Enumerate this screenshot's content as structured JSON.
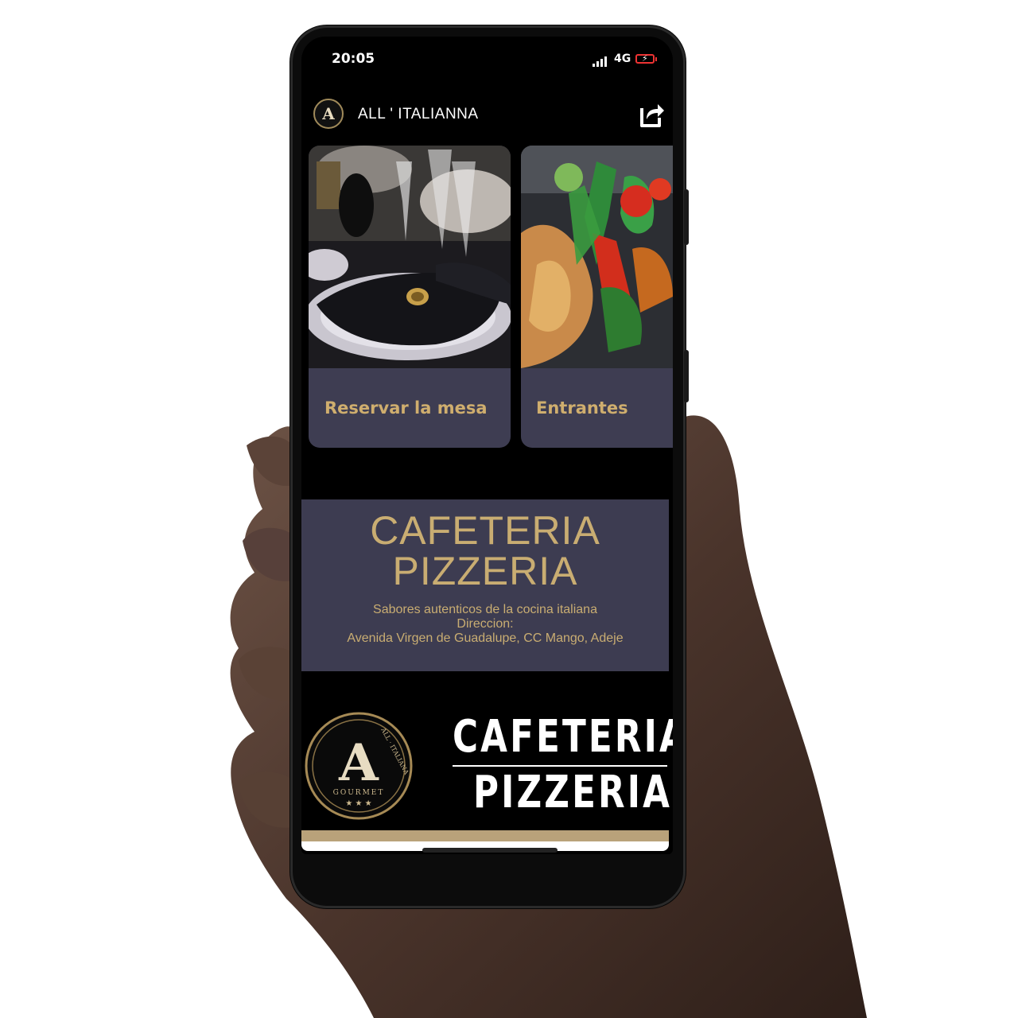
{
  "status_bar": {
    "time": "20:05",
    "network": "4G"
  },
  "header": {
    "logo_letter": "A",
    "title": "ALL ' ITALIANNA",
    "share_icon": "share-icon"
  },
  "cards": [
    {
      "label": "Reservar la mesa",
      "image": "table-setting-photo"
    },
    {
      "label": "Entrantes",
      "image": "salad-dish-photo"
    }
  ],
  "banner": {
    "title": "CAFETERIA PIZZERIA",
    "line1": "Sabores autenticos de la cocina italiana",
    "line2": "Direccion:",
    "line3": "Avenida Virgen de Guadalupe, CC Mango, Adeje"
  },
  "brand": {
    "logo_letter": "A",
    "logo_arc_text": "ALL · ITALIANA",
    "logo_sub": "GOURMET",
    "logo_stars": "★ ★ ★",
    "word1": "CAFETERIA",
    "word2": "PIZZERIA"
  },
  "colors": {
    "gold": "#c9ad72",
    "card_bg": "#3e3d52",
    "banner_bg": "#3d3c51",
    "screen_bg": "#000000"
  }
}
